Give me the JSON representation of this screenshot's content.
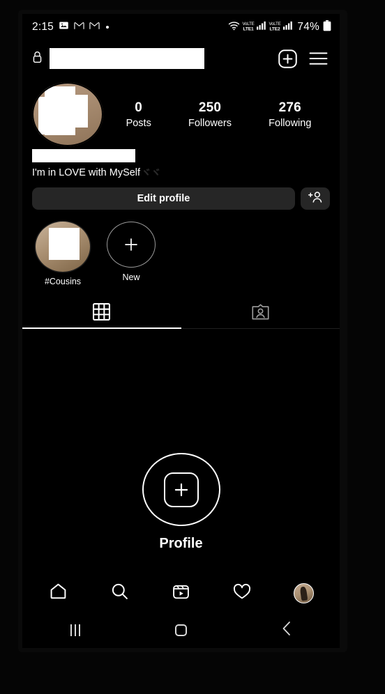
{
  "status_bar": {
    "time": "2:15",
    "left_icons": [
      "gallery-icon",
      "gmail-icon",
      "gmail-icon",
      "dot-icon"
    ],
    "wifi_icon": "wifi-icon",
    "sim1_volte_top": "VoLTE",
    "sim1_volte_bottom": "LTE1",
    "sim2_volte_top": "VoLTE",
    "sim2_volte_bottom": "LTE2",
    "battery_percent": "74%",
    "battery_icon": "battery-icon"
  },
  "header": {
    "lock_icon": "lock-icon",
    "username_redacted": "",
    "add_icon": "plus-square-icon",
    "menu_icon": "hamburger-menu-icon"
  },
  "profile": {
    "avatar_alt": "profile-photo-redacted",
    "name_redacted": "",
    "bio": "I'm in LOVE with MySelf",
    "bio_emoji": "ヾヾ",
    "stats": [
      {
        "value": "0",
        "label": "Posts"
      },
      {
        "value": "250",
        "label": "Followers"
      },
      {
        "value": "276",
        "label": "Following"
      }
    ]
  },
  "actions": {
    "edit_profile_label": "Edit profile",
    "add_person_icon": "add-person-icon"
  },
  "highlights": [
    {
      "label": "#Cousins",
      "type": "photo"
    },
    {
      "label": "New",
      "type": "new"
    }
  ],
  "tabs": [
    {
      "icon": "grid-icon",
      "active": true
    },
    {
      "icon": "tagged-person-icon",
      "active": false
    }
  ],
  "empty_state": {
    "icon": "plus-rounded-square-icon",
    "label": "Profile"
  },
  "bottom_nav": [
    {
      "icon": "home-icon",
      "active": false
    },
    {
      "icon": "search-icon",
      "active": false
    },
    {
      "icon": "reels-icon",
      "active": false
    },
    {
      "icon": "heart-icon",
      "active": false
    },
    {
      "icon": "profile-avatar-icon",
      "active": true
    }
  ],
  "system_nav": {
    "recents_icon": "recents-icon",
    "home_icon": "home-square-icon",
    "back_icon": "back-chevron-icon"
  },
  "colors": {
    "background": "#000000",
    "surface": "#262626",
    "text": "#ffffff",
    "redaction": "#ffffff",
    "divider": "#1f1f1f"
  }
}
